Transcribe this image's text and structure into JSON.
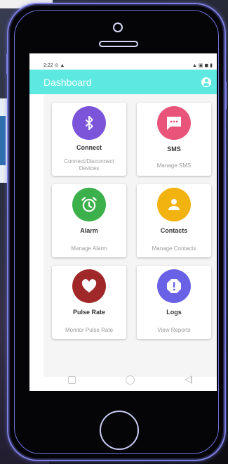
{
  "statusbar": {
    "left": "2:22 ⊙ ▲",
    "right": "▲ ▣ ◼ ▮"
  },
  "appbar": {
    "title": "Dashboard",
    "icon": "account-circle-icon"
  },
  "cards": [
    {
      "title": "Connect",
      "subtitle": "Connect/Disconnect Devices",
      "icon": "bluetooth-icon",
      "color": "#7b54d9"
    },
    {
      "title": "SMS",
      "subtitle": "Manage SMS",
      "icon": "sms-icon",
      "color": "#e9557a"
    },
    {
      "title": "Alarm",
      "subtitle": "Manage Alarm",
      "icon": "alarm-icon",
      "color": "#3cb04a"
    },
    {
      "title": "Contacts",
      "subtitle": "Manage Contacts",
      "icon": "contact-icon",
      "color": "#f2b20f"
    },
    {
      "title": "Pulse Rate",
      "subtitle": "Monitor Pulse Rate",
      "icon": "heart-icon",
      "color": "#a02828"
    },
    {
      "title": "Logs",
      "subtitle": "View Reports",
      "icon": "alert-icon",
      "color": "#6a62e6"
    }
  ],
  "navbar": {
    "items": [
      "recent-apps-icon",
      "home-icon",
      "back-icon"
    ]
  }
}
